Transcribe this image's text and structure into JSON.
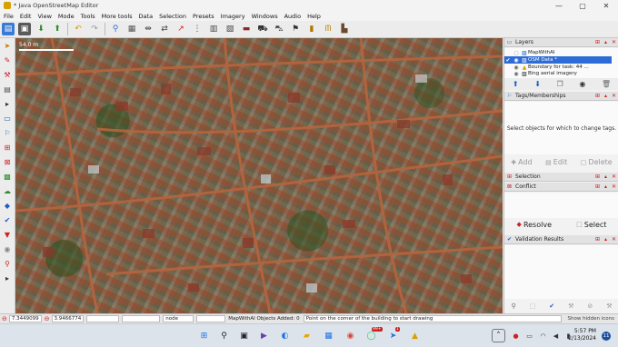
{
  "window": {
    "title": "* Java OpenStreetMap Editor",
    "controls": [
      "—",
      "▢",
      "✕"
    ]
  },
  "menu": [
    "File",
    "Edit",
    "View",
    "Mode",
    "Tools",
    "More tools",
    "Data",
    "Selection",
    "Presets",
    "Imagery",
    "Windows",
    "Audio",
    "Help"
  ],
  "map": {
    "scale_label": "54.0 m"
  },
  "layers_panel": {
    "title": "Layers",
    "layers": [
      {
        "name": "MapWithAI",
        "selected": false
      },
      {
        "name": "OSM Data *",
        "selected": true
      },
      {
        "name": "Boundary for task: 44 ...",
        "selected": false
      },
      {
        "name": "Bing aerial imagery",
        "selected": false
      }
    ]
  },
  "tags_panel": {
    "title": "Tags/Memberships",
    "message": "Select objects for which to change tags.",
    "add_label": "Add",
    "edit_label": "Edit",
    "delete_label": "Delete"
  },
  "selection_panel": {
    "title": "Selection"
  },
  "conflict_panel": {
    "title": "Conflict",
    "resolve_label": "Resolve",
    "select_label": "Select"
  },
  "validation_panel": {
    "title": "Validation Results"
  },
  "statusbar": {
    "lat": "7.3449099",
    "lon": "3.9466774",
    "heading": "node",
    "mapwithai": "MapWithAI Objects Added: 0",
    "hint": "Point on the corner of the building to start drawing",
    "hidden_icons": "Show hidden icons"
  },
  "taskbar": {
    "time": "5:57 PM",
    "date": "2/13/2024",
    "notifications": "11",
    "badge_99": "99+",
    "badge_1": "1"
  },
  "colors": {
    "selected_row": "#2d6bd6",
    "accent_red": "#c22"
  }
}
